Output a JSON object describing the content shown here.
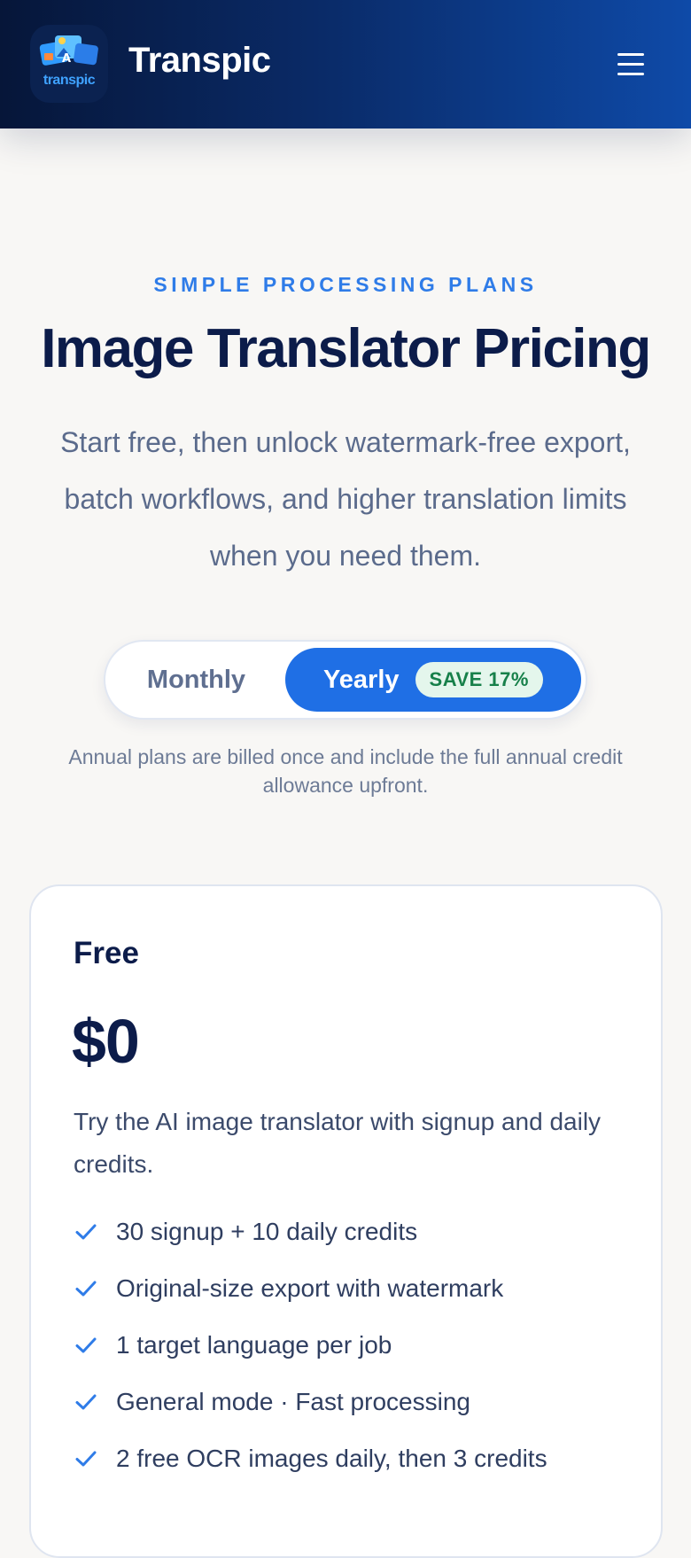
{
  "header": {
    "logo_text": "transpic",
    "brand": "Transpic",
    "menu_icon": "hamburger-icon"
  },
  "hero": {
    "eyebrow": "SIMPLE PROCESSING PLANS",
    "title": "Image Translator Pricing",
    "subtitle": "Start free, then unlock watermark-free export, batch workflows, and higher translation limits when you need them."
  },
  "billing_toggle": {
    "monthly_label": "Monthly",
    "yearly_label": "Yearly",
    "save_badge": "SAVE 17%",
    "selected": "Yearly",
    "note": "Annual plans are billed once and include the full annual credit allowance upfront."
  },
  "plans": [
    {
      "name": "Free",
      "price": "$0",
      "description": "Try the AI image translator with signup and daily credits.",
      "features": [
        "30 signup + 10 daily credits",
        "Original-size export with watermark",
        "1 target language per job",
        "General mode · Fast processing",
        "2 free OCR images daily, then 3 credits"
      ]
    }
  ],
  "colors": {
    "accent": "#1f6fe5",
    "eyebrow": "#2f7ce8",
    "heading": "#0c1c4a",
    "save_badge_bg": "#e4f6ec",
    "save_badge_text": "#17804a",
    "header_dark": "#061639",
    "header_light": "#0e4aa8"
  }
}
